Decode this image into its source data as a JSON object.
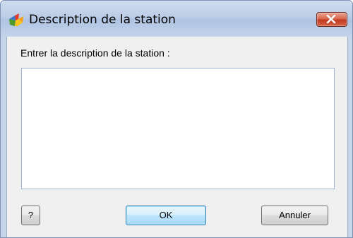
{
  "window": {
    "title": "Description de la station",
    "icon": "avg-app-icon",
    "close_icon": "close-icon"
  },
  "form": {
    "prompt_label": "Entrer la description de la station :",
    "description_value": "",
    "description_placeholder": ""
  },
  "buttons": {
    "help_label": "?",
    "ok_label": "OK",
    "cancel_label": "Annuler"
  },
  "colors": {
    "titlebar": "#bccde6",
    "close_button": "#c0391e",
    "dialog_background": "#f0f0f0",
    "default_button_border": "#3c7fb1"
  }
}
